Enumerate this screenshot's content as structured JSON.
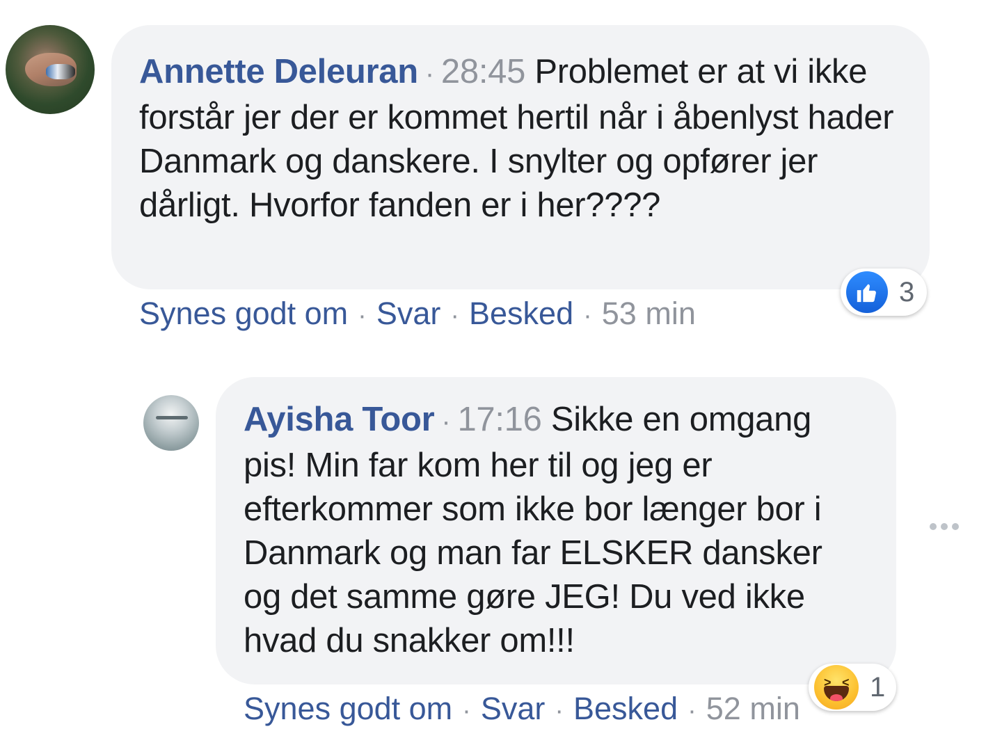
{
  "comments": [
    {
      "author": "Annette Deleuran",
      "timestamp": "28:45",
      "text": "Problemet er at vi ikke forstår jer der er kommet hertil når i åbenlyst hader Danmark og danskere. I snylter og opfører jer dårligt. Hvorfor fanden er i her????",
      "actions": {
        "like": "Synes godt om",
        "reply": "Svar",
        "message": "Besked",
        "time": "53 min"
      },
      "reaction": {
        "icon": "like-icon",
        "count": "3"
      }
    },
    {
      "author": "Ayisha Toor",
      "timestamp": "17:16",
      "text": "Sikke en omgang pis! Min far kom her til og jeg er efterkommer som ikke bor længer bor i Danmark og man far ELSKER dansker og det samme gøre JEG! Du ved ikke hvad du snakker om!!!",
      "actions": {
        "like": "Synes godt om",
        "reply": "Svar",
        "message": "Besked",
        "time": "52 min"
      },
      "reaction": {
        "icon": "haha-icon",
        "count": "1"
      }
    }
  ],
  "separator": "·",
  "colors": {
    "link": "#385898",
    "muted": "#90949c",
    "bubble": "#f2f3f5",
    "like_blue": "#1877f2"
  }
}
